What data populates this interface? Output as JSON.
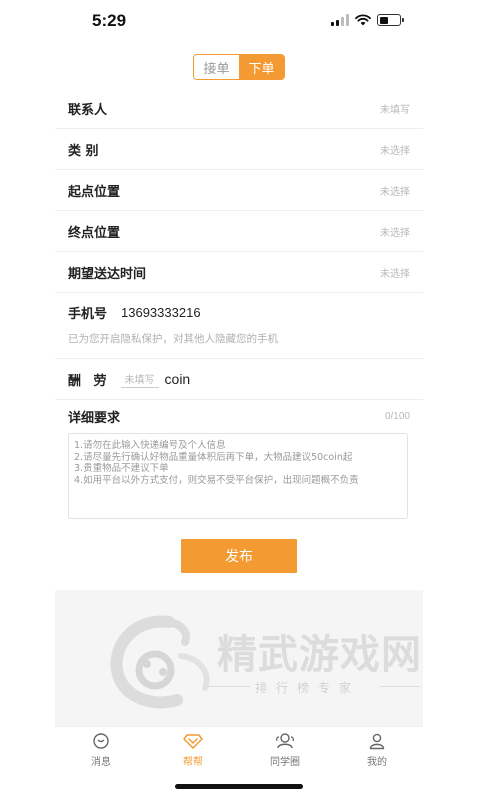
{
  "status_bar": {
    "time": "5:29"
  },
  "mode_toggle": {
    "options": [
      "接单",
      "下单"
    ],
    "active_index": 1
  },
  "form": {
    "rows": [
      {
        "label": "联系人",
        "value": "未填写"
      },
      {
        "label": "类 别",
        "value": "未选择"
      },
      {
        "label": "起点位置",
        "value": "未选择"
      },
      {
        "label": "终点位置",
        "value": "未选择"
      },
      {
        "label": "期望送达时间",
        "value": "未选择"
      }
    ],
    "phone": {
      "label": "手机号",
      "value": "13693333216",
      "note": "已为您开启隐私保护，对其他人隐藏您的手机"
    },
    "reward": {
      "label": "酬 劳",
      "placeholder": "未填写",
      "unit": "coin"
    },
    "details": {
      "label": "详细要求",
      "counter": "0/100",
      "placeholder_lines": [
        "1.请勿在此输入快递编号及个人信息",
        "2.请尽量先行确认好物品重量体积后再下单，大物品建议50coin起",
        "3.贵重物品不建议下单",
        "4.如用平台以外方式支付，则交易不受平台保护，出现问题概不负责"
      ]
    }
  },
  "submit_label": "发布",
  "watermark": {
    "title": "精武游戏网",
    "subtitle": "排行榜专家"
  },
  "tabbar": {
    "items": [
      {
        "label": "消息",
        "icon": "message-icon"
      },
      {
        "label": "帮帮",
        "icon": "help-diamond-icon"
      },
      {
        "label": "同学圈",
        "icon": "classmates-icon"
      },
      {
        "label": "我的",
        "icon": "profile-icon"
      }
    ],
    "active_index": 1
  },
  "colors": {
    "accent": "#f39a32",
    "text": "#222222",
    "muted": "#b8b8b8",
    "grey_area": "#f5f5f5"
  }
}
